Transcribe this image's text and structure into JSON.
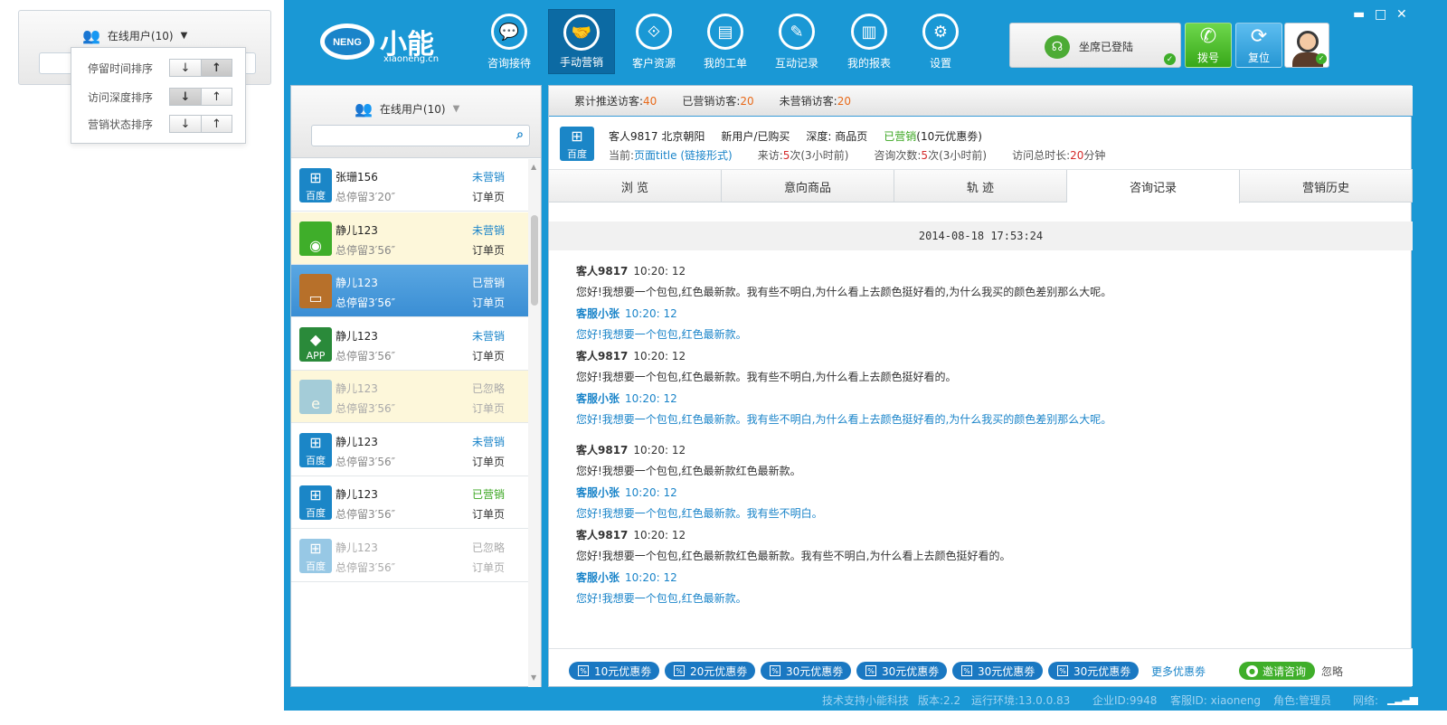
{
  "popup": {
    "title": "在线用户(10)",
    "sort_options": [
      {
        "label": "停留时间排序",
        "active": "up"
      },
      {
        "label": "访问深度排序",
        "active": "down"
      },
      {
        "label": "营销状态排序",
        "active": "none"
      }
    ],
    "down_glyph": "↓",
    "up_glyph": "↑"
  },
  "app": {
    "logo_text": "小能",
    "logo_sub": "xiaoneng.cn",
    "logo_badge": "NENG",
    "nav": [
      {
        "label": "咨询接待",
        "icon": "chat-bubble-icon"
      },
      {
        "label": "手动营销",
        "icon": "handshake-icon"
      },
      {
        "label": "客户资源",
        "icon": "share-nodes-icon"
      },
      {
        "label": "我的工单",
        "icon": "document-icon"
      },
      {
        "label": "互动记录",
        "icon": "pencil-icon"
      },
      {
        "label": "我的报表",
        "icon": "bar-chart-icon"
      },
      {
        "label": "设置",
        "icon": "gear-icon"
      }
    ],
    "active_nav": 1,
    "agent_status": "坐席已登陆",
    "dial_label": "拨号",
    "reset_label": "复位"
  },
  "left": {
    "title": "在线用户(10)",
    "search_placeholder": "",
    "visitors": [
      {
        "name": "张珊156",
        "stay": "总停留3′20″",
        "status": "未营销",
        "page": "订单页",
        "source": "baidu",
        "icon_label": "百度",
        "state": "normal"
      },
      {
        "name": "静儿123",
        "stay": "总停留3′56″",
        "status": "未营销",
        "page": "订单页",
        "source": "wechat",
        "icon_label": "",
        "state": "highlight"
      },
      {
        "name": "静儿123",
        "stay": "总停留3′56″",
        "status": "已营销",
        "page": "订单页",
        "source": "chat",
        "icon_label": "",
        "state": "selected"
      },
      {
        "name": "静儿123",
        "stay": "总停留3′56″",
        "status": "未营销",
        "page": "订单页",
        "source": "app",
        "icon_label": "APP",
        "state": "normal"
      },
      {
        "name": "静儿123",
        "stay": "总停留3′56″",
        "status": "已忽略",
        "page": "订单页",
        "source": "ie",
        "icon_label": "",
        "state": "dim-highlight"
      },
      {
        "name": "静儿123",
        "stay": "总停留3′56″",
        "status": "未营销",
        "page": "订单页",
        "source": "baidu",
        "icon_label": "百度",
        "state": "normal"
      },
      {
        "name": "静儿123",
        "stay": "总停留3′56″",
        "status": "已营销",
        "page": "订单页",
        "source": "baidu",
        "icon_label": "百度",
        "state": "normal-green"
      },
      {
        "name": "静儿123",
        "stay": "总停留3′56″",
        "status": "已忽略",
        "page": "订单页",
        "source": "baidu",
        "icon_label": "百度",
        "state": "dim"
      }
    ]
  },
  "stats": {
    "pushed_label": "累计推送访客:",
    "pushed_value": "40",
    "marketed_label": "已营销访客:",
    "marketed_value": "20",
    "unmarketed_label": "未营销访客:",
    "unmarketed_value": "20"
  },
  "customer": {
    "icon_label": "百度",
    "name_loc": "客人9817 北京朝阳",
    "type": "新用户/已购买",
    "depth": "深度: 商品页",
    "status": "已营销",
    "coupon": "(10元优惠劵)",
    "current_label": "当前:",
    "current_value": "页面title (链接形式)",
    "visits_label": "来访:",
    "visits_value": "5",
    "visits_suffix": "次(3小时前)",
    "consult_label": "咨询次数:",
    "consult_value": "5",
    "consult_suffix": "次(3小时前)",
    "duration_label": "访问总时长:",
    "duration_value": "20",
    "duration_suffix": "分钟"
  },
  "tabs": [
    "浏  览",
    "意向商品",
    "轨  迹",
    "咨询记录",
    "营销历史"
  ],
  "active_tab": 3,
  "chat": {
    "date": "2014-08-18 17:53:24",
    "messages": [
      {
        "role": "cust",
        "who": "客人9817",
        "time": "10:20: 12",
        "text": "您好!我想要一个包包,红色最新款。我有些不明白,为什么看上去颜色挺好看的,为什么我买的颜色差别那么大呢。"
      },
      {
        "role": "agent",
        "who": "客服小张",
        "time": "10:20: 12",
        "text": "您好!我想要一个包包,红色最新款。"
      },
      {
        "role": "cust",
        "who": "客人9817",
        "time": "10:20: 12",
        "text": "您好!我想要一个包包,红色最新款。我有些不明白,为什么看上去颜色挺好看的。"
      },
      {
        "role": "agent",
        "who": "客服小张",
        "time": "10:20: 12",
        "text": "您好!我想要一个包包,红色最新款。我有些不明白,为什么看上去颜色挺好看的,为什么我买的颜色差别那么大呢。"
      },
      {
        "role": "cust",
        "who": "客人9817",
        "time": "10:20: 12",
        "text": "您好!我想要一个包包,红色最新款红色最新款。"
      },
      {
        "role": "agent",
        "who": "客服小张",
        "time": "10:20: 12",
        "text": "您好!我想要一个包包,红色最新款。我有些不明白。"
      },
      {
        "role": "cust",
        "who": "客人9817",
        "time": "10:20: 12",
        "text": "您好!我想要一个包包,红色最新款红色最新款。我有些不明白,为什么看上去颜色挺好看的。"
      },
      {
        "role": "agent",
        "who": "客服小张",
        "time": "10:20: 12",
        "text": "您好!我想要一个包包,红色最新款。"
      }
    ]
  },
  "coupons": [
    "10元优惠劵",
    "20元优惠劵",
    "30元优惠劵",
    "30元优惠劵",
    "30元优惠劵",
    "30元优惠劵"
  ],
  "more_coupons": "更多优惠劵",
  "invite": "邀请咨询",
  "ignore": "忽略",
  "status_bar": {
    "support": "技术支持小能科技",
    "version": "版本:2.2",
    "runtime": "运行环境:13.0.0.83",
    "enterprise": "企业ID:9948",
    "agent_id": "客服ID: xiaoneng",
    "role": "角色:管理员",
    "network": "网络:"
  },
  "colors": {
    "primary": "#1a98d5",
    "accent_orange": "#e86a1a",
    "green": "#3aa620",
    "link_blue": "#1a84c9"
  }
}
